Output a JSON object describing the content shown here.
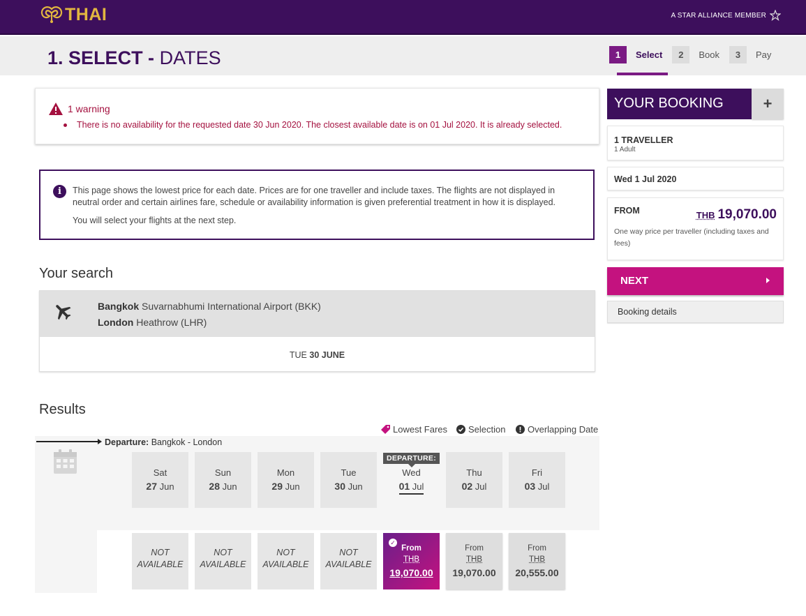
{
  "header": {
    "logo_text": "THAI",
    "alliance_text": "A STAR ALLIANCE MEMBER"
  },
  "stepbar": {
    "title_num": "1.",
    "title_strong": "SELECT -",
    "title_light": "DATES",
    "steps": [
      {
        "num": "1",
        "label": "Select",
        "active": true
      },
      {
        "num": "2",
        "label": "Book",
        "active": false
      },
      {
        "num": "3",
        "label": "Pay",
        "active": false
      }
    ]
  },
  "warning": {
    "title": "1 warning",
    "message": "There is no availability for the requested date 30 Jun 2020. The closest available date is on 01 Jul 2020. It is already selected."
  },
  "info": {
    "icon": "i",
    "text": "This page shows the lowest price for each date. Prices are for one traveller and include taxes. The flights are not displayed in neutral order and certain airlines fare, schedule or availability information is given preferential treatment in how it is displayed.",
    "text2": "You will select your flights at the next step."
  },
  "search": {
    "heading": "Your search",
    "origin_city": "Bangkok",
    "origin_airport": "Suvarnabhumi International Airport (BKK)",
    "dest_city": "London",
    "dest_airport": "Heathrow (LHR)",
    "date_dow": "TUE",
    "date_day": "30 JUNE"
  },
  "results": {
    "heading": "Results",
    "legend": {
      "lowest": "Lowest Fares",
      "selection": "Selection",
      "overlap": "Overlapping Date"
    },
    "departure_label": "Departure:",
    "departure_route": "Bangkok - London",
    "departure_tag": "DEPARTURE:",
    "dates": [
      {
        "dow": "Sat",
        "day": "27",
        "mon": "Jun"
      },
      {
        "dow": "Sun",
        "day": "28",
        "mon": "Jun"
      },
      {
        "dow": "Mon",
        "day": "29",
        "mon": "Jun"
      },
      {
        "dow": "Tue",
        "day": "30",
        "mon": "Jun"
      },
      {
        "dow": "Wed",
        "day": "01",
        "mon": "Jul"
      },
      {
        "dow": "Thu",
        "day": "02",
        "mon": "Jul"
      },
      {
        "dow": "Fri",
        "day": "03",
        "mon": "Jul"
      }
    ],
    "na_line1": "NOT",
    "na_line2": "AVAILABLE",
    "from_label": "From",
    "currency": "THB",
    "prices": [
      "19,070.00",
      "19,070.00",
      "20,555.00"
    ]
  },
  "booking": {
    "heading": "YOUR BOOKING",
    "plus": "+",
    "travellers": "1 TRAVELLER",
    "travellers_detail": "1 Adult",
    "date": "Wed 1 Jul 2020",
    "from_label": "FROM",
    "currency": "THB",
    "price": "19,070.00",
    "note": "One way price per traveller (including taxes and fees)",
    "next_label": "NEXT",
    "details_label": "Booking details"
  },
  "colors": {
    "brand_purple": "#3d0f5c",
    "accent_magenta": "#c4127f",
    "warning_red": "#a4113f",
    "logo_gold": "#e2b640"
  }
}
